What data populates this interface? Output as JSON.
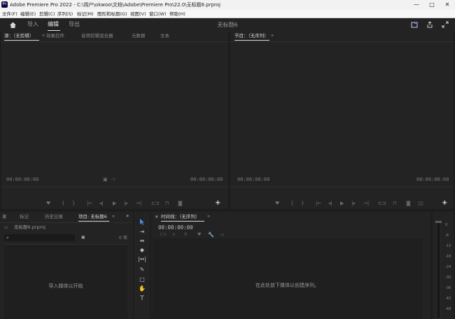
{
  "window": {
    "logo": "Pr",
    "title": "Adobe Premiere Pro 2022 - C:\\用户\\okwoo\\文档\\Adobe\\Premiere Pro\\22.0\\无标题6.prproj",
    "controls": [
      "—",
      "□",
      "✕"
    ]
  },
  "menu": [
    "文件(F)",
    "编辑(E)",
    "剪辑(C)",
    "序列(S)",
    "标记(M)",
    "图形和标题(G)",
    "视图(V)",
    "窗口(W)",
    "帮助(H)"
  ],
  "workspace": {
    "home_icon": "home-icon",
    "tabs": [
      "导入",
      "编辑",
      "导出"
    ],
    "active_tab": "编辑",
    "document_name": "无标题6"
  },
  "source_panel": {
    "tabs": [
      "源：（无剪辑）",
      "效果控件",
      "音频剪辑混合器",
      "元数据",
      "文本"
    ],
    "timecode_left": "00:00:00:00",
    "timecode_right": "00:00:00:00"
  },
  "program_panel": {
    "title": "节目：（无序列）",
    "timecode_left": "00:00:00:00",
    "timecode_right": "00:00:00:00"
  },
  "project_panel": {
    "tabs": [
      "果",
      "标记",
      "历史记录",
      "项目: 无标题6"
    ],
    "file": "无标题6.prproj",
    "search_placeholder": "",
    "item_count": "0 项",
    "empty_text": "导入媒体以开始"
  },
  "timeline_panel": {
    "title": "时间线：（无序列）",
    "timecode": "00:00:00:00",
    "empty_text": "在此处放下媒体以创建序列。"
  },
  "audio_meter": {
    "ticks": [
      "0",
      "-6",
      "-12",
      "-18",
      "-24",
      "-30",
      "-36",
      "-42",
      "-48"
    ]
  }
}
